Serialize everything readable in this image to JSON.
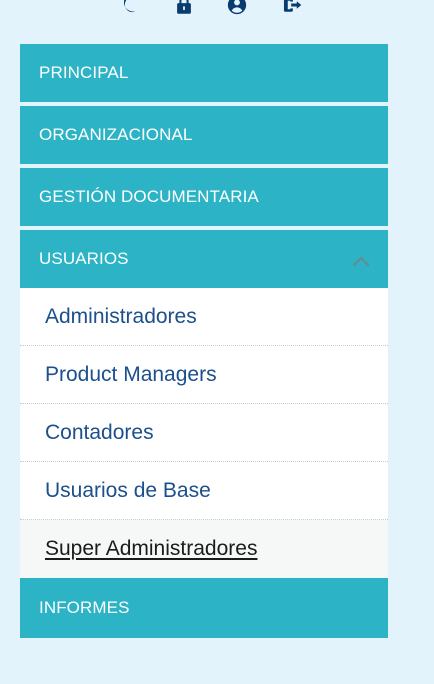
{
  "topbar": {
    "icons": [
      {
        "name": "moon-icon",
        "color": "#083b70"
      },
      {
        "name": "lock-icon",
        "color": "#083b70"
      },
      {
        "name": "user-circle-icon",
        "color": "#083b70"
      },
      {
        "name": "logout-icon",
        "color": "#083b70"
      }
    ]
  },
  "menu": {
    "items": [
      {
        "label": "PRINCIPAL"
      },
      {
        "label": "ORGANIZACIONAL"
      },
      {
        "label": "GESTIÓN DOCUMENTARIA"
      },
      {
        "label": "USUARIOS",
        "expanded": true,
        "chevron": "chevron-up-icon"
      },
      {
        "label": "INFORMES"
      }
    ],
    "usuarios_submenu": [
      {
        "label": "Administradores"
      },
      {
        "label": "Product Managers"
      },
      {
        "label": "Contadores"
      },
      {
        "label": "Usuarios de Base"
      },
      {
        "label": "Super Administradores",
        "active": true
      }
    ]
  },
  "colors": {
    "background": "#e3f3fb",
    "menu_bar": "#2cb4c6",
    "menu_text": "#ffffff",
    "submenu_bg": "#ffffff",
    "submenu_text": "#1c4f8b",
    "active_text": "#1b1b1b",
    "chevron": "#5d8f97"
  }
}
